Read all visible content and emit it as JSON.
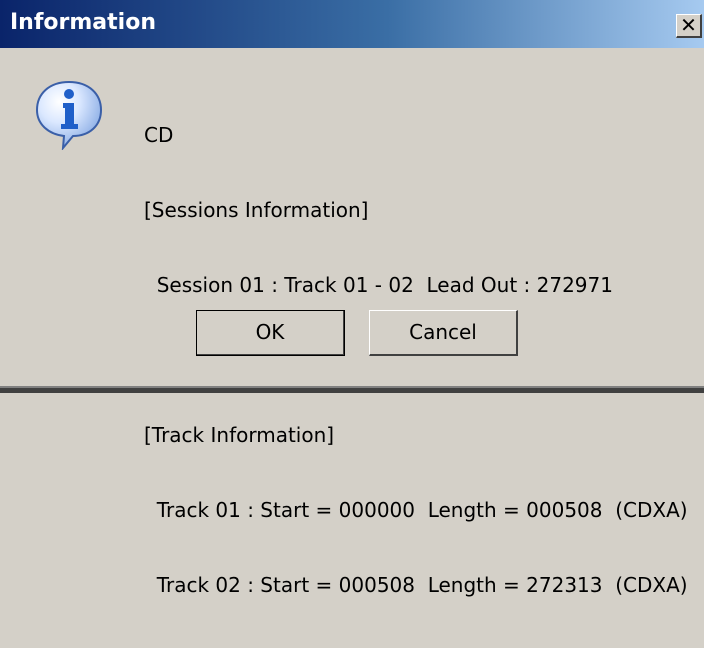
{
  "window": {
    "title": "Information",
    "close_glyph": "✕"
  },
  "icon": {
    "name": "info-icon",
    "glyph": "i",
    "color": "#1f5fc9"
  },
  "message": {
    "lines": [
      "CD",
      "[Sessions Information]",
      "  Session 01 : Track 01 - 02  Lead Out : 272971",
      "",
      "[Track Information]",
      "  Track 01 : Start = 000000  Length = 000508  (CDXA)",
      "  Track 02 : Start = 000508  Length = 272313  (CDXA)"
    ]
  },
  "buttons": {
    "ok_label": "OK",
    "cancel_label": "Cancel"
  }
}
